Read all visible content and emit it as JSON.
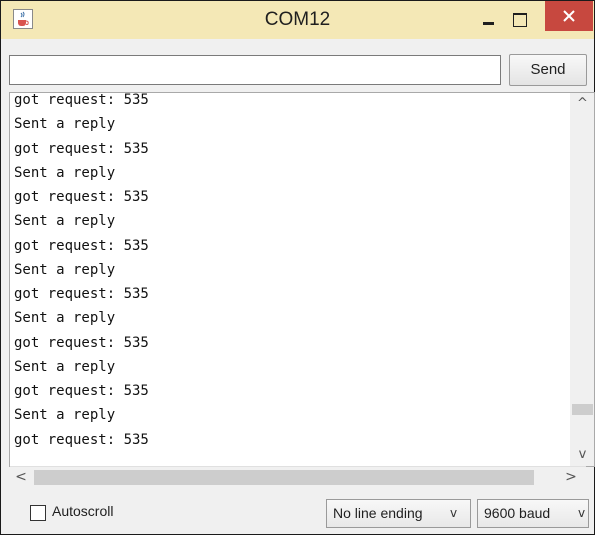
{
  "window": {
    "title": "COM12",
    "icon": "java-cup-icon"
  },
  "input": {
    "value": "",
    "placeholder": ""
  },
  "toolbar": {
    "send_label": "Send"
  },
  "console": {
    "lines": [
      "got request: 535",
      "Sent a reply",
      "got request: 535",
      "Sent a reply",
      "got request: 535",
      "Sent a reply",
      "got request: 535",
      "Sent a reply",
      "got request: 535",
      "Sent a reply",
      "got request: 535",
      "Sent a reply",
      "got request: 535",
      "Sent a reply",
      "got request: 535"
    ]
  },
  "scrollbars": {
    "up": "^",
    "down": "v",
    "left": "<",
    "right": ">"
  },
  "footer": {
    "autoscroll_label": "Autoscroll",
    "autoscroll_checked": false,
    "line_ending": "No line ending",
    "baud": "9600 baud",
    "chevron": "v"
  },
  "colors": {
    "titlebar": "#f4e8b6",
    "close": "#c7483f"
  }
}
